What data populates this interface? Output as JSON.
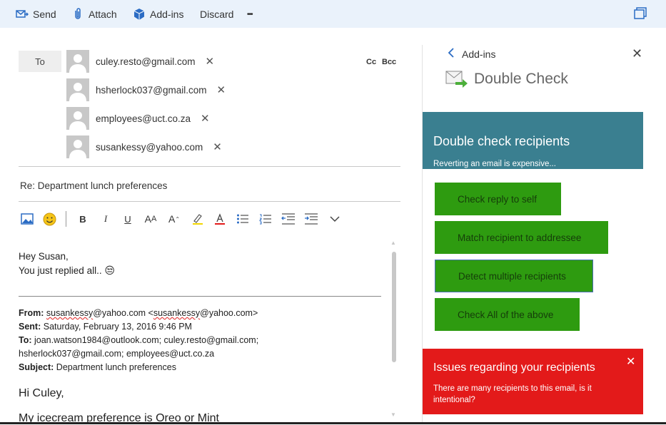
{
  "toolbar": {
    "send": "Send",
    "attach": "Attach",
    "addins": "Add-ins",
    "discard": "Discard",
    "more": "•••"
  },
  "compose": {
    "to_label": "To",
    "cc_label": "Cc",
    "bcc_label": "Bcc",
    "remove_glyph": "✕",
    "recipients": [
      "culey.resto@gmail.com",
      "hsherlock037@gmail.com",
      "employees@uct.co.za",
      "susankessy@yahoo.com"
    ],
    "subject": "Re: Department lunch preferences"
  },
  "message": {
    "greeting": "Hey Susan,",
    "line2": "You just replied all..",
    "emoji": "😒",
    "from_label": "From:",
    "from_name": "susankessy",
    "from_rest": "@yahoo.com <",
    "from_name2": "susankessy",
    "from_rest2": "@yahoo.com>",
    "sent_label": "Sent:",
    "sent_value": "Saturday, February 13, 2016 9:46 PM",
    "to_label": "To:",
    "to_value_line1": "joan.watson1984@outlook.com; culey.resto@gmail.com;",
    "to_value_line2": "hsherlock037@gmail.com; employees@uct.co.za",
    "subject_label": "Subject:",
    "subject_value": "Department lunch preferences",
    "hi": "Hi Culey,",
    "pref": "My icecream preference is Oreo or Mint"
  },
  "panel": {
    "back_label": "Add-ins",
    "title": "Double Check",
    "close_glyph": "✕",
    "header": "Double check recipients",
    "subheader": "Reverting an email is expensive...",
    "buttons": [
      "Check reply to self",
      "Match recipient to addressee",
      "Detect multiple recipients",
      "Check All of the above"
    ],
    "alert_title": "Issues regarding your recipients",
    "alert_text": "There are many recipients to this email, is it intentional?",
    "alert_close": "✕"
  },
  "colors": {
    "toolbar_bg": "#eaf2fb",
    "accent_blue": "#2b6cc4",
    "teal_header": "#3a7f90",
    "button_green": "#2e9b10",
    "alert_red": "#e31a1a"
  }
}
